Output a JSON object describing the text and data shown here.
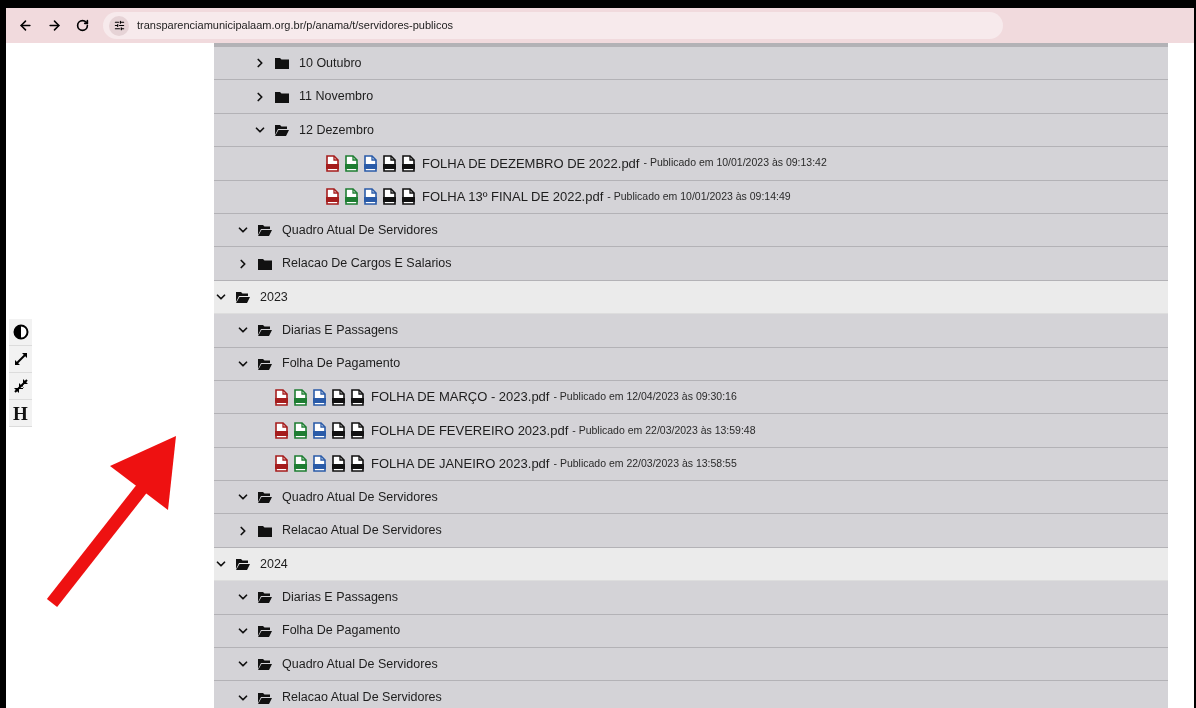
{
  "browser": {
    "url": "transparenciamunicipalaam.org.br/p/anama/t/servidores-publicos"
  },
  "accessibility_toolbar": [
    {
      "kind": "contrast"
    },
    {
      "kind": "expand"
    },
    {
      "kind": "shrink"
    },
    {
      "kind": "heading",
      "label": "H"
    }
  ],
  "tree": [
    {
      "kind": "hidden",
      "children": [
        {
          "kind": "hidden",
          "children": [
            {
              "kind": "folder",
              "label": "10 Outubro",
              "expanded": false
            },
            {
              "kind": "folder",
              "label": "11 Novembro",
              "expanded": false
            },
            {
              "kind": "folder",
              "label": "12 Dezembro",
              "expanded": true,
              "children": [
                {
                  "kind": "file",
                  "name": "FOLHA DE DEZEMBRO DE 2022.pdf",
                  "published": "- Publicado em 10/01/2023 às 09:13:42"
                },
                {
                  "kind": "file",
                  "name": "FOLHA 13º FINAL DE 2022.pdf",
                  "published": "- Publicado em 10/01/2023 às 09:14:49"
                }
              ]
            }
          ]
        },
        {
          "kind": "folder",
          "label": "Quadro Atual De Servidores",
          "expanded": true
        },
        {
          "kind": "folder",
          "label": "Relacao De Cargos E Salarios",
          "expanded": false
        }
      ]
    },
    {
      "kind": "year",
      "label": "2023",
      "expanded": true,
      "children": [
        {
          "kind": "folder",
          "label": "Diarias E Passagens",
          "expanded": true
        },
        {
          "kind": "folder",
          "label": "Folha De Pagamento",
          "expanded": true,
          "children": [
            {
              "kind": "file",
              "name": "FOLHA DE MARÇO - 2023.pdf",
              "published": "- Publicado em 12/04/2023 às 09:30:16"
            },
            {
              "kind": "file",
              "name": "FOLHA DE FEVEREIRO 2023.pdf",
              "published": "- Publicado em 22/03/2023 às 13:59:48"
            },
            {
              "kind": "file",
              "name": "FOLHA DE JANEIRO 2023.pdf",
              "published": "- Publicado em 22/03/2023 às 13:58:55"
            }
          ]
        },
        {
          "kind": "folder",
          "label": "Quadro Atual De Servidores",
          "expanded": true
        },
        {
          "kind": "folder",
          "label": "Relacao Atual De Servidores",
          "expanded": false
        }
      ]
    },
    {
      "kind": "year",
      "label": "2024",
      "expanded": true,
      "children": [
        {
          "kind": "folder",
          "label": "Diarias E Passagens",
          "expanded": true
        },
        {
          "kind": "folder",
          "label": "Folha De Pagamento",
          "expanded": true
        },
        {
          "kind": "folder",
          "label": "Quadro Atual De Servidores",
          "expanded": true
        },
        {
          "kind": "folder",
          "label": "Relacao Atual De Servidores",
          "expanded": true
        }
      ]
    }
  ]
}
